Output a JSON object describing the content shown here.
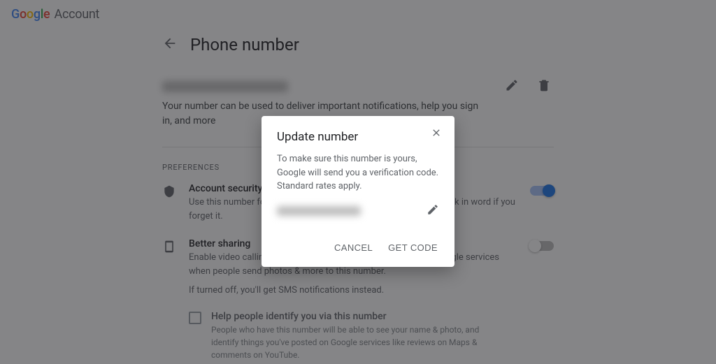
{
  "header": {
    "logo_account": "Account"
  },
  "page": {
    "title": "Phone number",
    "description": "Your number can be used to deliver important notifications, help you sign in, and more"
  },
  "preferences": {
    "label": "Preferences",
    "items": [
      {
        "title": "Account security",
        "desc": "Use this number for added security to help you sign in and get back in word if you forget it.",
        "toggle": "on"
      },
      {
        "title": "Better sharing",
        "desc": "Enable video calling, and get fewer SMS notifications & more Google services when people send photos & more to this number.",
        "note": "If turned off, you'll get SMS notifications instead.",
        "toggle": "off"
      }
    ],
    "checkbox": {
      "title": "Help people identify you via this number",
      "desc": "People who have this number will be able to see your name & photo, and identify things you've posted on Google services like reviews on Maps & comments on YouTube."
    }
  },
  "dialog": {
    "title": "Update number",
    "text": "To make sure this number is yours, Google will send you a verification code. Standard rates apply.",
    "cancel": "CANCEL",
    "get_code": "GET CODE"
  }
}
